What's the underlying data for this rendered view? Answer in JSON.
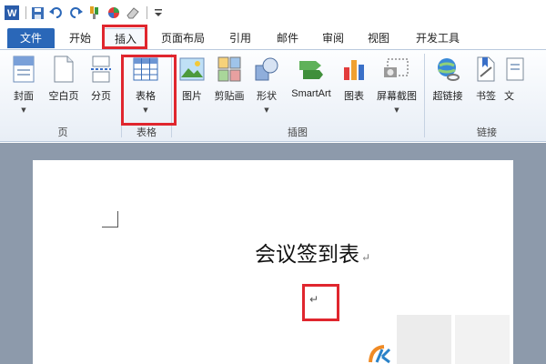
{
  "quick_access": {
    "items": [
      "word-logo-icon",
      "save-icon",
      "undo-icon",
      "redo-icon",
      "format-painter-icon",
      "color-icon",
      "eraser-icon",
      "customize-icon"
    ]
  },
  "tabs": [
    {
      "label": "文件"
    },
    {
      "label": "开始"
    },
    {
      "label": "插入"
    },
    {
      "label": "页面布局"
    },
    {
      "label": "引用"
    },
    {
      "label": "邮件"
    },
    {
      "label": "审阅"
    },
    {
      "label": "视图"
    },
    {
      "label": "开发工具"
    }
  ],
  "active_tab": "插入",
  "ribbon": {
    "buttons": {
      "cover": "封面",
      "blank_page": "空白页",
      "page_break": "分页",
      "table": "表格",
      "picture": "图片",
      "clipart": "剪贴画",
      "shapes": "形状",
      "smartart": "SmartArt",
      "chart": "图表",
      "screenshot": "屏幕截图",
      "hyperlink": "超链接",
      "bookmark": "书签",
      "cross_ref": "文"
    },
    "groups": {
      "pages": "页",
      "tables": "表格",
      "illustrations": "插图",
      "links": "链接"
    }
  },
  "document": {
    "title": "会议签到表",
    "paragraph_mark": "↵"
  },
  "colors": {
    "file_tab": "#2a67b8",
    "highlight": "#e0262e",
    "doc_background": "#8d9aab"
  }
}
